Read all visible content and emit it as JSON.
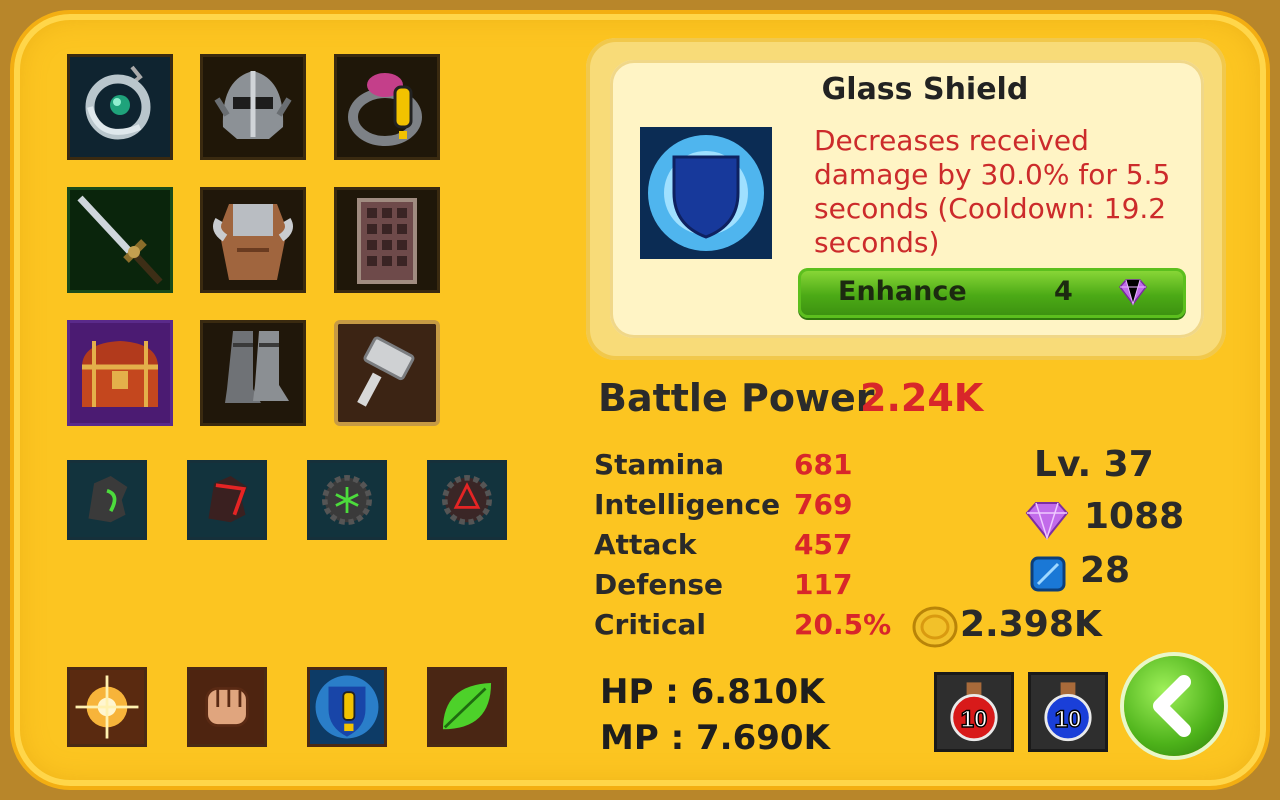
{
  "equipment": {
    "items": [
      {
        "name": "amulet"
      },
      {
        "name": "helmet"
      },
      {
        "name": "ring"
      },
      {
        "name": "sword"
      },
      {
        "name": "armor"
      },
      {
        "name": "scroll"
      },
      {
        "name": "chest"
      },
      {
        "name": "boots"
      },
      {
        "name": "hammer"
      }
    ],
    "runes": [
      "rune-green-wing",
      "rune-red-wing",
      "rune-green-gear",
      "rune-red-gear"
    ],
    "skills": [
      "light-burst",
      "fist",
      "shield-alert",
      "leaf"
    ]
  },
  "detail": {
    "title": "Glass Shield",
    "description": "Decreases received damage by 30.0% for 5.5 seconds (Cooldown: 19.2 seconds)",
    "enhance_label": "Enhance",
    "enhance_cost": "4"
  },
  "battle_power": {
    "label": "Battle Power",
    "value": "2.24K"
  },
  "stats": [
    {
      "name": "Stamina",
      "value": "681"
    },
    {
      "name": "Intelligence",
      "value": "769"
    },
    {
      "name": "Attack",
      "value": "457"
    },
    {
      "name": "Defense",
      "value": "117"
    },
    {
      "name": "Critical",
      "value": "20.5%"
    }
  ],
  "level": "Lv. 37",
  "resources": {
    "gems": "1088",
    "crystals": "28",
    "gold": "2.398K"
  },
  "vitals": {
    "hp": "HP : 6.810K",
    "mp": "MP : 7.690K"
  },
  "potions": [
    {
      "count": "10",
      "color": "#d81a1a"
    },
    {
      "count": "10",
      "color": "#1a3fd8"
    }
  ],
  "colors": {
    "panel": "#fcc521",
    "accent_red": "#d8262a",
    "enhance_green": "#4caa16"
  }
}
